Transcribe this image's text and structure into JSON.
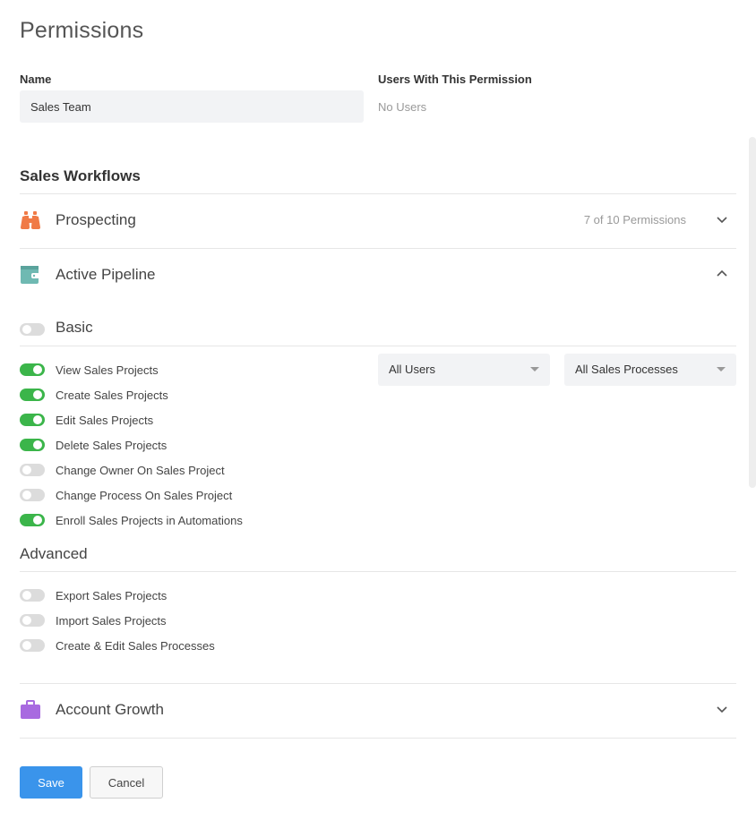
{
  "page": {
    "title": "Permissions"
  },
  "form": {
    "name_label": "Name",
    "name_value": "Sales Team",
    "users_label": "Users With This Permission",
    "users_value": "No Users"
  },
  "section": {
    "title": "Sales Workflows"
  },
  "workflows": [
    {
      "label": "Prospecting",
      "count": "7 of 10 Permissions",
      "expanded": false,
      "icon": "binoculars-icon",
      "color": "#f07a46"
    },
    {
      "label": "Active Pipeline",
      "expanded": true,
      "icon": "wallet-icon",
      "color": "#6fb9b2"
    },
    {
      "label": "Account Growth",
      "expanded": false,
      "icon": "briefcase-icon",
      "color": "#a86ae0"
    }
  ],
  "basic": {
    "label": "Basic",
    "enabled": false,
    "permissions": [
      {
        "label": "View Sales Projects",
        "on": true
      },
      {
        "label": "Create Sales Projects",
        "on": true
      },
      {
        "label": "Edit Sales Projects",
        "on": true
      },
      {
        "label": "Delete Sales Projects",
        "on": true
      },
      {
        "label": "Change Owner On Sales Project",
        "on": false
      },
      {
        "label": "Change Process On Sales Project",
        "on": false
      },
      {
        "label": "Enroll Sales Projects in Automations",
        "on": true
      }
    ],
    "scope_users": "All Users",
    "scope_processes": "All Sales Processes"
  },
  "advanced": {
    "label": "Advanced",
    "permissions": [
      {
        "label": "Export Sales Projects",
        "on": false
      },
      {
        "label": "Import Sales Projects",
        "on": false
      },
      {
        "label": "Create & Edit Sales Processes",
        "on": false
      }
    ]
  },
  "actions": {
    "save_label": "Save",
    "cancel_label": "Cancel"
  },
  "colors": {
    "accent": "#3a94eb",
    "toggle_on": "#3bb54a",
    "toggle_off": "#dcdcdc"
  }
}
